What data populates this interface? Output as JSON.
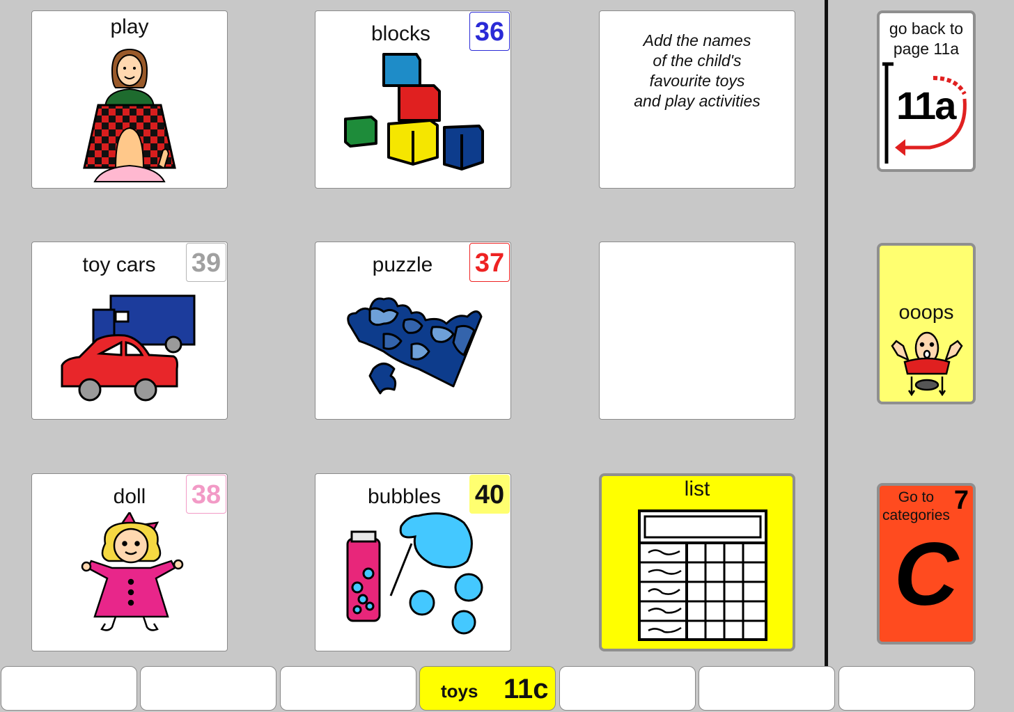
{
  "grid": {
    "play": {
      "label": "play"
    },
    "blocks": {
      "label": "blocks",
      "number": "36",
      "number_color": "#2a2ad6"
    },
    "note": {
      "line1": "Add the names",
      "line2": "of the child's",
      "line3": "favourite toys",
      "line4": "and play activities"
    },
    "toy_cars": {
      "label": "toy cars",
      "number": "39",
      "number_color": "#a0a0a0"
    },
    "puzzle": {
      "label": "puzzle",
      "number": "37",
      "number_color": "#ee2222"
    },
    "doll": {
      "label": "doll",
      "number": "38",
      "number_color": "#f29ac6"
    },
    "bubbles": {
      "label": "bubbles",
      "number": "40",
      "number_color": "#111111"
    },
    "list": {
      "label": "list"
    }
  },
  "side": {
    "go_back": {
      "line1": "go back to",
      "line2": "page 11a",
      "page_code": "11a"
    },
    "ooops": {
      "label": "ooops"
    },
    "categories": {
      "line1": "Go to",
      "line2": "categories",
      "number": "7",
      "letter": "C"
    }
  },
  "tabs": {
    "active_label": "toys",
    "active_code": "11c"
  },
  "colors": {
    "background": "#c8c8c8",
    "yellow": "#ffff00",
    "light_yellow": "#ffff70",
    "orange_red": "#ff4b1f"
  }
}
